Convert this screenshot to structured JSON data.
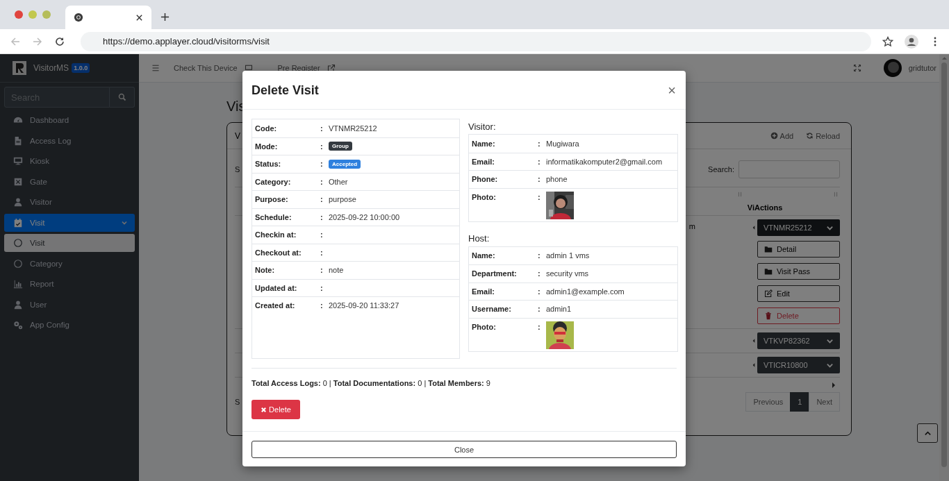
{
  "browser": {
    "url": "https://demo.applayer.cloud/visitorms/visit"
  },
  "sidebar": {
    "brand": "VisitorMS",
    "version": "1.0.0",
    "search": {
      "placeholder": "Search"
    },
    "items": [
      {
        "label": "Dashboard",
        "selected": false
      },
      {
        "label": "Access Log",
        "selected": false
      },
      {
        "label": "Kiosk",
        "selected": false
      },
      {
        "label": "Gate",
        "selected": false
      },
      {
        "label": "Visitor",
        "selected": false
      },
      {
        "label": "Visit",
        "selected": true,
        "expanded": true,
        "children": [
          {
            "label": "Visit",
            "selected": true
          },
          {
            "label": "Category",
            "selected": false
          }
        ]
      },
      {
        "label": "Report",
        "selected": false
      },
      {
        "label": "User",
        "selected": false
      },
      {
        "label": "App Config",
        "selected": false
      }
    ]
  },
  "topbar": {
    "links": [
      "Check This Device",
      "Pre Register"
    ],
    "user": "gridtutor"
  },
  "page": {
    "title": "Vis",
    "card": {
      "title": "V",
      "actions": [
        "Add",
        "Reload"
      ],
      "length_label": "S",
      "search_label": "Search:",
      "columns": [
        "Vi",
        "Actions"
      ],
      "rows": [
        {
          "cell": "m",
          "code": "VTNMR25212",
          "expanded": true,
          "menu": [
            {
              "label": "Detail",
              "kind": "folder"
            },
            {
              "label": "Visit Pass",
              "kind": "folder"
            },
            {
              "label": "Edit",
              "kind": "edit"
            },
            {
              "label": "Delete",
              "kind": "danger"
            }
          ]
        },
        {
          "code": "VTKVP82362",
          "expanded": false
        },
        {
          "code": "VTICR10800",
          "expanded": false
        }
      ],
      "info": "S",
      "pagination": [
        {
          "label": "Previous",
          "selected": false
        },
        {
          "label": "1",
          "selected": true
        },
        {
          "label": "Next",
          "selected": false
        }
      ]
    }
  },
  "modal": {
    "title": "Delete Visit",
    "close": "×",
    "details": [
      {
        "label": "Code:",
        "sep": ":",
        "kind": "text",
        "value": "VTNMR25212"
      },
      {
        "label": "Mode:",
        "sep": ":",
        "kind": "badge",
        "value": "Group",
        "color": "#343a40"
      },
      {
        "label": "Status:",
        "sep": ":",
        "kind": "badge",
        "value": "Accepted",
        "color": "#2f80de"
      },
      {
        "label": "Category:",
        "sep": ":",
        "kind": "text",
        "value": "Other"
      },
      {
        "label": "Purpose:",
        "sep": ":",
        "kind": "text",
        "value": "purpose"
      },
      {
        "label": "Schedule:",
        "sep": ":",
        "kind": "text",
        "value": "2025-09-22 10:00:00"
      },
      {
        "label": "Checkin at:",
        "sep": ":",
        "kind": "text"
      },
      {
        "label": "Checkout at:",
        "sep": ":",
        "kind": "text"
      },
      {
        "label": "Note:",
        "sep": ":",
        "kind": "text",
        "value": "note"
      },
      {
        "label": "Updated at:",
        "sep": ":",
        "kind": "text"
      },
      {
        "label": "Created at:",
        "sep": ":",
        "kind": "text",
        "value": "2025-09-20 11:33:27"
      }
    ],
    "sections": [
      {
        "title": "Visitor:",
        "rows": [
          {
            "label": "Name:",
            "sep": ":",
            "kind": "text",
            "value": "Mugiwara"
          },
          {
            "label": "Email:",
            "sep": ":",
            "kind": "text",
            "value": "informatikakomputer2@gmail.com"
          },
          {
            "label": "Phone:",
            "sep": ":",
            "kind": "text",
            "value": "phone"
          },
          {
            "label": "Photo:",
            "sep": ":",
            "kind": "picture"
          }
        ]
      },
      {
        "title": "Host:",
        "rows": [
          {
            "label": "Name:",
            "sep": ":",
            "kind": "text",
            "value": "admin 1 vms"
          },
          {
            "label": "Department:",
            "sep": ":",
            "kind": "text",
            "value": "security vms"
          },
          {
            "label": "Email:",
            "sep": ":",
            "kind": "text",
            "value": "admin1@example.com"
          },
          {
            "label": "Username:",
            "sep": ":",
            "kind": "text",
            "value": "admin1"
          },
          {
            "label": "Photo:",
            "sep": ":",
            "kind": "picture"
          }
        ]
      }
    ],
    "totals": "**Total Access Logs:** 0 | **Total Documentations:** 0 | **Total Members:** 9",
    "delete_button": "Delete",
    "close_button": "Close"
  }
}
